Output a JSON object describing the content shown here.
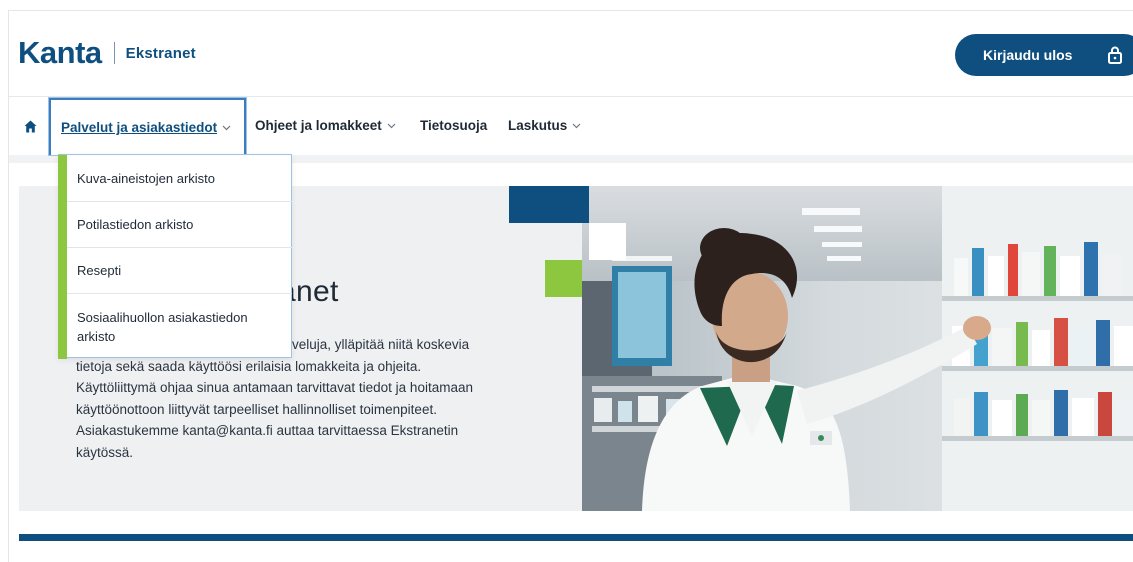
{
  "brand": {
    "logo_text": "Kanta",
    "product": "Ekstranet"
  },
  "header": {
    "logout_label": "Kirjaudu ulos",
    "logout_icon": "lock-icon"
  },
  "nav": {
    "home_icon": "home-icon",
    "items": [
      {
        "label": "Palvelut ja asiakastiedot",
        "has_menu": true,
        "active": true
      },
      {
        "label": "Ohjeet ja lomakkeet",
        "has_menu": true
      },
      {
        "label": "Tietosuoja",
        "has_menu": false
      },
      {
        "label": "Laskutus",
        "has_menu": true
      }
    ]
  },
  "dropdown": {
    "items": [
      {
        "label": "Kuva-aineistojen arkisto"
      },
      {
        "label": "Potilastiedon arkisto"
      },
      {
        "label": "Resepti"
      },
      {
        "label": "Sosiaalihuollon asiakastiedon arkisto"
      }
    ]
  },
  "hero": {
    "title_partial": "anet",
    "text_line_1": "palveluja, ylläpitää niitä koskevia",
    "text_line_2": "tietoja sekä saada käyttöösi erilaisia lomakkeita ja ohjeita.",
    "text_line_3": "Käyttöliittymä ohjaa sinua antamaan tarvittavat tiedot ja hoitamaan",
    "text_line_4": "käyttöönottoon liittyvät tarpeelliset hallinnolliset toimenpiteet.",
    "text_line_5": "Asiakastukemme kanta@kanta.fi auttaa tarvittaessa Ekstranetin",
    "text_line_6": "käytössä."
  },
  "colors": {
    "brand_navy": "#0e4f80",
    "accent_green": "#8dc63f",
    "focus_blue": "#3b7dbe"
  }
}
